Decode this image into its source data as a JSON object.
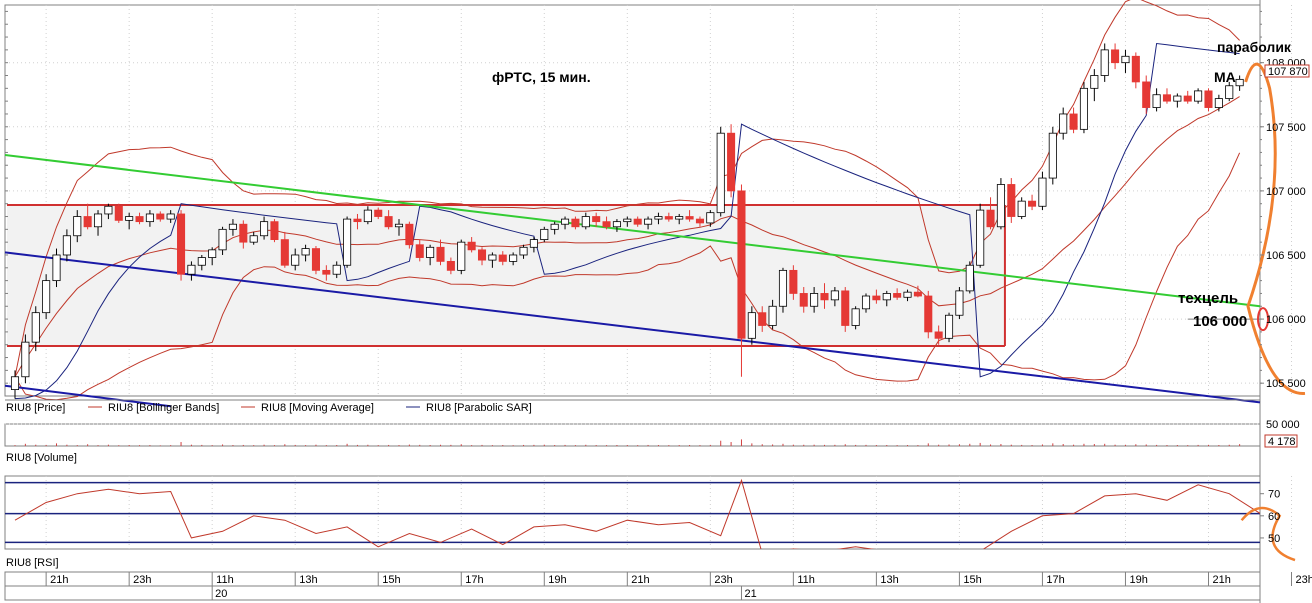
{
  "chart_data": [
    {
      "type": "candlestick",
      "panel": "price",
      "title": "фРТС, 15 мин.",
      "ylim": [
        105400,
        108450
      ],
      "y_ticks": [
        {
          "v": 108000,
          "label": "108 000"
        },
        {
          "v": 107500,
          "label": "107 500"
        },
        {
          "v": 107000,
          "label": "107 000"
        },
        {
          "v": 106500,
          "label": "106 500"
        },
        {
          "v": 106000,
          "label": "106 000"
        },
        {
          "v": 105500,
          "label": "105 500"
        }
      ],
      "last_price_label": "107 870",
      "range_box": {
        "top": 106890,
        "bottom": 105790
      },
      "annotations": {
        "parabolic": "параболик",
        "ma": "MA",
        "target": "техцель",
        "target_value": "106 000"
      },
      "legend": [
        {
          "label": "RIU8 [Price]",
          "color": "#000000"
        },
        {
          "label": "RIU8 [Bollinger Bands]",
          "color": "#c0392b"
        },
        {
          "label": "RIU8 [Moving Average]",
          "color": "#c0392b"
        },
        {
          "label": "RIU8 [Parabolic SAR]",
          "color": "#1a237e"
        }
      ],
      "colors": {
        "up": "#ffffff",
        "down": "#e53935",
        "bb": "#c0392b",
        "ma": "#c0392b",
        "sar": "#1a237e",
        "trend_green": "#33cc33",
        "trend_blue": "#1a1aa6",
        "forecast": "#f08030",
        "box_fill": "#f2f2f2",
        "box_line": "#d03030"
      },
      "candles": [
        [
          105450,
          105600,
          105380,
          105550
        ],
        [
          105550,
          105880,
          105500,
          105820
        ],
        [
          105820,
          106100,
          105750,
          106050
        ],
        [
          106050,
          106350,
          106000,
          106300
        ],
        [
          106300,
          106550,
          106250,
          106500
        ],
        [
          106500,
          106700,
          106450,
          106650
        ],
        [
          106650,
          106850,
          106600,
          106800
        ],
        [
          106800,
          106900,
          106700,
          106720
        ],
        [
          106720,
          106850,
          106650,
          106820
        ],
        [
          106820,
          106900,
          106780,
          106880
        ],
        [
          106880,
          106900,
          106750,
          106770
        ],
        [
          106770,
          106830,
          106700,
          106800
        ],
        [
          106800,
          106830,
          106740,
          106760
        ],
        [
          106760,
          106850,
          106720,
          106820
        ],
        [
          106820,
          106840,
          106760,
          106780
        ],
        [
          106780,
          106850,
          106750,
          106820
        ],
        [
          106820,
          106850,
          106300,
          106350
        ],
        [
          106350,
          106450,
          106300,
          106420
        ],
        [
          106420,
          106500,
          106380,
          106480
        ],
        [
          106480,
          106560,
          106420,
          106540
        ],
        [
          106540,
          106720,
          106500,
          106700
        ],
        [
          106700,
          106780,
          106650,
          106740
        ],
        [
          106740,
          106770,
          106550,
          106600
        ],
        [
          106600,
          106680,
          106580,
          106650
        ],
        [
          106650,
          106800,
          106620,
          106760
        ],
        [
          106760,
          106780,
          106600,
          106620
        ],
        [
          106620,
          106680,
          106400,
          106420
        ],
        [
          106420,
          106550,
          106380,
          106500
        ],
        [
          106500,
          106580,
          106450,
          106550
        ],
        [
          106550,
          106570,
          106350,
          106380
        ],
        [
          106380,
          106420,
          106300,
          106350
        ],
        [
          106350,
          106450,
          106320,
          106420
        ],
        [
          106420,
          106800,
          106400,
          106780
        ],
        [
          106780,
          106820,
          106700,
          106760
        ],
        [
          106760,
          106880,
          106740,
          106850
        ],
        [
          106850,
          106870,
          106780,
          106800
        ],
        [
          106800,
          106850,
          106700,
          106720
        ],
        [
          106720,
          106780,
          106650,
          106740
        ],
        [
          106740,
          106760,
          106550,
          106580
        ],
        [
          106580,
          106620,
          106450,
          106480
        ],
        [
          106480,
          106580,
          106420,
          106560
        ],
        [
          106560,
          106620,
          106420,
          106450
        ],
        [
          106450,
          106480,
          106350,
          106380
        ],
        [
          106380,
          106620,
          106350,
          106600
        ],
        [
          106600,
          106640,
          106520,
          106540
        ],
        [
          106540,
          106560,
          106420,
          106460
        ],
        [
          106460,
          106520,
          106400,
          106500
        ],
        [
          106500,
          106530,
          106420,
          106450
        ],
        [
          106450,
          106520,
          106420,
          106500
        ],
        [
          106500,
          106580,
          106470,
          106560
        ],
        [
          106560,
          106640,
          106520,
          106620
        ],
        [
          106620,
          106720,
          106600,
          106700
        ],
        [
          106700,
          106760,
          106660,
          106740
        ],
        [
          106740,
          106800,
          106700,
          106780
        ],
        [
          106780,
          106800,
          106700,
          106720
        ],
        [
          106720,
          106830,
          106700,
          106800
        ],
        [
          106800,
          106830,
          106720,
          106760
        ],
        [
          106760,
          106800,
          106700,
          106720
        ],
        [
          106720,
          106780,
          106680,
          106760
        ],
        [
          106760,
          106800,
          106720,
          106780
        ],
        [
          106780,
          106800,
          106720,
          106740
        ],
        [
          106740,
          106800,
          106700,
          106780
        ],
        [
          106780,
          106830,
          106740,
          106800
        ],
        [
          106800,
          106830,
          106760,
          106780
        ],
        [
          106780,
          106820,
          106740,
          106800
        ],
        [
          106800,
          106850,
          106760,
          106780
        ],
        [
          106780,
          106800,
          106720,
          106750
        ],
        [
          106750,
          106850,
          106720,
          106830
        ],
        [
          106830,
          107500,
          106800,
          107450
        ],
        [
          107450,
          107520,
          106950,
          107000
        ],
        [
          107000,
          107050,
          105550,
          105850
        ],
        [
          105850,
          106100,
          105800,
          106050
        ],
        [
          106050,
          106100,
          105900,
          105950
        ],
        [
          105950,
          106150,
          105920,
          106100
        ],
        [
          106100,
          106400,
          106050,
          106380
        ],
        [
          106380,
          106420,
          106150,
          106200
        ],
        [
          106200,
          106250,
          106050,
          106100
        ],
        [
          106100,
          106250,
          106050,
          106200
        ],
        [
          106200,
          106280,
          106080,
          106150
        ],
        [
          106150,
          106250,
          106100,
          106220
        ],
        [
          106220,
          106250,
          105900,
          105950
        ],
        [
          105950,
          106100,
          105920,
          106080
        ],
        [
          106080,
          106200,
          106050,
          106180
        ],
        [
          106180,
          106230,
          106120,
          106150
        ],
        [
          106150,
          106220,
          106100,
          106200
        ],
        [
          106200,
          106240,
          106150,
          106170
        ],
        [
          106170,
          106230,
          106140,
          106210
        ],
        [
          106210,
          106260,
          106170,
          106180
        ],
        [
          106180,
          106220,
          105850,
          105900
        ],
        [
          105900,
          105950,
          105800,
          105850
        ],
        [
          105850,
          106050,
          105820,
          106030
        ],
        [
          106030,
          106250,
          106000,
          106220
        ],
        [
          106220,
          106450,
          106200,
          106420
        ],
        [
          106420,
          106900,
          106400,
          106850
        ],
        [
          106850,
          106950,
          106700,
          106720
        ],
        [
          106720,
          107100,
          106700,
          107050
        ],
        [
          107050,
          107100,
          106750,
          106800
        ],
        [
          106800,
          106950,
          106780,
          106920
        ],
        [
          106920,
          106970,
          106850,
          106880
        ],
        [
          106880,
          107150,
          106850,
          107100
        ],
        [
          107100,
          107500,
          107050,
          107450
        ],
        [
          107450,
          107650,
          107400,
          107600
        ],
        [
          107600,
          107650,
          107450,
          107480
        ],
        [
          107480,
          107850,
          107450,
          107800
        ],
        [
          107800,
          107950,
          107700,
          107900
        ],
        [
          107900,
          108150,
          107850,
          108100
        ],
        [
          108100,
          108150,
          107950,
          108000
        ],
        [
          108000,
          108100,
          107920,
          108050
        ],
        [
          108050,
          108080,
          107800,
          107850
        ],
        [
          107850,
          107900,
          107600,
          107650
        ],
        [
          107650,
          107800,
          107620,
          107750
        ],
        [
          107750,
          107800,
          107680,
          107700
        ],
        [
          107700,
          107760,
          107650,
          107740
        ],
        [
          107740,
          107780,
          107680,
          107700
        ],
        [
          107700,
          107800,
          107680,
          107780
        ],
        [
          107780,
          107800,
          107620,
          107650
        ],
        [
          107650,
          107750,
          107620,
          107720
        ],
        [
          107720,
          107850,
          107700,
          107820
        ],
        [
          107820,
          107900,
          107780,
          107870
        ]
      ]
    },
    {
      "type": "bar",
      "panel": "volume",
      "legend": "RIU8 [Volume]",
      "y_ticks": [
        {
          "v": 50000,
          "label": "50 000"
        }
      ],
      "last_value_label": "4 178",
      "ylim": [
        0,
        50000
      ],
      "values": [
        2000,
        5000,
        3000,
        2500,
        6000,
        3000,
        2000,
        4000,
        2000,
        3000,
        1800,
        2200,
        1900,
        2100,
        1500,
        2000,
        9000,
        3000,
        2500,
        2000,
        3500,
        2200,
        2400,
        2000,
        3000,
        2000,
        4000,
        2500,
        2000,
        3000,
        2000,
        2200,
        5000,
        2500,
        2800,
        2000,
        2400,
        2100,
        3200,
        2600,
        2300,
        2800,
        2600,
        4000,
        2000,
        2500,
        2000,
        2200,
        1800,
        2400,
        2600,
        3000,
        2200,
        2500,
        2000,
        2800,
        2100,
        2000,
        2300,
        2200,
        2000,
        2400,
        2200,
        2000,
        2100,
        2300,
        2000,
        2500,
        12000,
        9000,
        15000,
        6000,
        4000,
        3500,
        5000,
        3000,
        2800,
        3000,
        2600,
        2700,
        4000,
        2500,
        2600,
        2200,
        2300,
        2000,
        2200,
        2100,
        6000,
        3000,
        3500,
        4000,
        5000,
        7000,
        3500,
        4500,
        3000,
        2500,
        2200,
        3500,
        6000,
        4500,
        3000,
        5000,
        4500,
        5000,
        3000,
        2800,
        4000,
        3500,
        2500,
        2200,
        2300,
        2000,
        2500,
        2600,
        2200,
        2800,
        4178
      ]
    },
    {
      "type": "line",
      "panel": "rsi",
      "legend": "RIU8 [RSI]",
      "ylim": [
        45,
        78
      ],
      "y_ticks": [
        {
          "v": 70,
          "label": "70"
        },
        {
          "v": 60,
          "label": "60"
        },
        {
          "v": 50,
          "label": "50"
        }
      ],
      "levels": [
        {
          "v": 75,
          "color": "#1a237e"
        },
        {
          "v": 61,
          "color": "#1a237e"
        },
        {
          "v": 48,
          "color": "#1a237e"
        }
      ],
      "points": [
        [
          0,
          58
        ],
        [
          3,
          66
        ],
        [
          6,
          70
        ],
        [
          9,
          72
        ],
        [
          12,
          70
        ],
        [
          15,
          71
        ],
        [
          17,
          50
        ],
        [
          20,
          53
        ],
        [
          23,
          60
        ],
        [
          26,
          58
        ],
        [
          29,
          52
        ],
        [
          32,
          55
        ],
        [
          35,
          46
        ],
        [
          38,
          52
        ],
        [
          41,
          48
        ],
        [
          44,
          54
        ],
        [
          47,
          47
        ],
        [
          50,
          55
        ],
        [
          53,
          56
        ],
        [
          56,
          53
        ],
        [
          59,
          58
        ],
        [
          62,
          56
        ],
        [
          65,
          57
        ],
        [
          68,
          51
        ],
        [
          70,
          76
        ],
        [
          72,
          43
        ],
        [
          75,
          45
        ],
        [
          78,
          44
        ],
        [
          81,
          46
        ],
        [
          84,
          44
        ],
        [
          87,
          43
        ],
        [
          90,
          44
        ],
        [
          93,
          44
        ],
        [
          96,
          53
        ],
        [
          99,
          60
        ],
        [
          102,
          61
        ],
        [
          105,
          69
        ],
        [
          108,
          70
        ],
        [
          111,
          67
        ],
        [
          114,
          74
        ],
        [
          117,
          70
        ],
        [
          120,
          61
        ],
        [
          123,
          62
        ],
        [
          126,
          60
        ],
        [
          128,
          59
        ],
        [
          130,
          62
        ],
        [
          133,
          61
        ]
      ]
    }
  ],
  "x_axis": {
    "hour_labels": [
      "21h",
      "23h",
      "11h",
      "13h",
      "15h",
      "17h",
      "19h",
      "21h",
      "23h",
      "11h",
      "13h",
      "15h",
      "17h",
      "19h",
      "21h",
      "23h"
    ],
    "day_labels": [
      "20",
      "21"
    ]
  }
}
